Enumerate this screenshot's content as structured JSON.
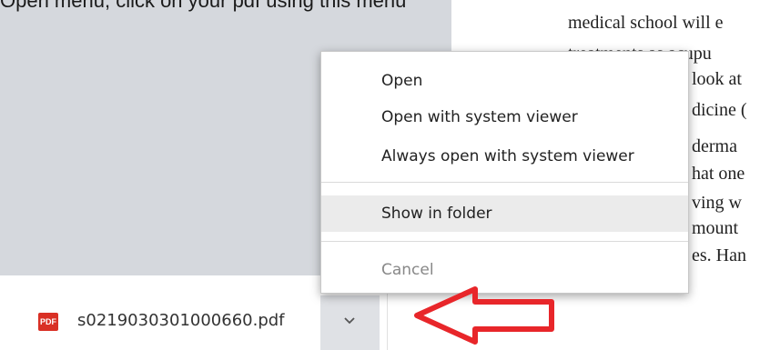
{
  "top_text": "Open menu, click on your pdf using this menu",
  "document": {
    "lines": [
      "medical school will e",
      "treatments as acupu",
      "look at",
      "dicine (",
      "derma",
      "hat one",
      "ving w",
      "mount",
      "es. Han"
    ]
  },
  "download": {
    "file_icon": "pdf-file-icon",
    "file_icon_text": "PDF",
    "file_name": "s0219030301000660.pdf",
    "menu_button_icon": "chevron-down-icon"
  },
  "context_menu": {
    "items": [
      {
        "label": "Open"
      },
      {
        "label": "Open with system viewer"
      },
      {
        "label": "Always open with system viewer"
      },
      {
        "label": "Show in folder",
        "state": "hovered"
      },
      {
        "label": "Cancel",
        "state": "disabled"
      }
    ]
  },
  "annotation": {
    "icon": "red-arrow-icon",
    "color": "#e8262a"
  }
}
